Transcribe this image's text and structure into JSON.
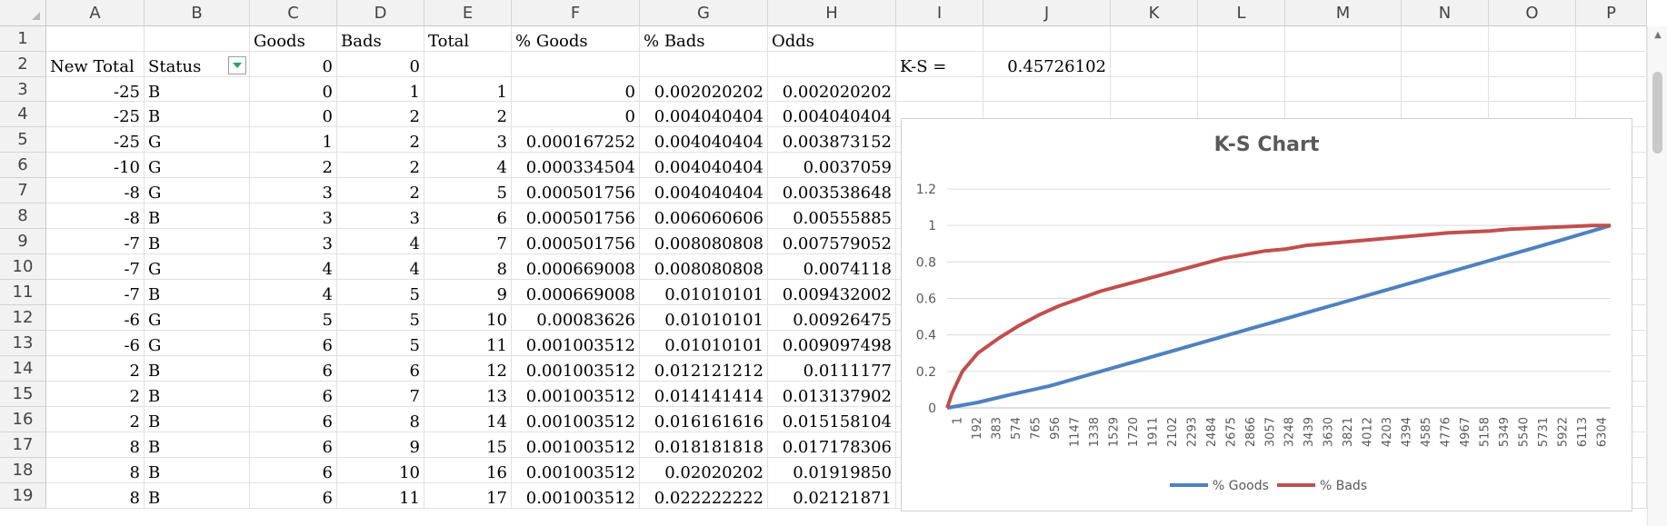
{
  "columns": [
    "A",
    "B",
    "C",
    "D",
    "E",
    "F",
    "G",
    "H",
    "I",
    "J",
    "K",
    "L",
    "M",
    "N",
    "O",
    "P"
  ],
  "row_numbers": [
    "1",
    "2",
    "3",
    "4",
    "5",
    "6",
    "7",
    "8",
    "9",
    "10",
    "11",
    "12",
    "13",
    "14",
    "15",
    "16",
    "17",
    "18",
    "19"
  ],
  "header_row": {
    "C": "Goods",
    "D": "Bads",
    "E": "Total",
    "F": "% Goods",
    "G": "% Bads",
    "H": "Odds"
  },
  "row2": {
    "A": "New Total",
    "B": "Status",
    "C": "0",
    "D": "0",
    "I": "K-S =",
    "J": "0.45726102"
  },
  "data_rows": [
    [
      "-25",
      "B",
      "0",
      "1",
      "1",
      "0",
      "0.002020202",
      "0.002020202"
    ],
    [
      "-25",
      "B",
      "0",
      "2",
      "2",
      "0",
      "0.004040404",
      "0.004040404"
    ],
    [
      "-25",
      "G",
      "1",
      "2",
      "3",
      "0.000167252",
      "0.004040404",
      "0.003873152"
    ],
    [
      "-10",
      "G",
      "2",
      "2",
      "4",
      "0.000334504",
      "0.004040404",
      "0.0037059"
    ],
    [
      "-8",
      "G",
      "3",
      "2",
      "5",
      "0.000501756",
      "0.004040404",
      "0.003538648"
    ],
    [
      "-8",
      "B",
      "3",
      "3",
      "6",
      "0.000501756",
      "0.006060606",
      "0.00555885"
    ],
    [
      "-7",
      "B",
      "3",
      "4",
      "7",
      "0.000501756",
      "0.008080808",
      "0.007579052"
    ],
    [
      "-7",
      "G",
      "4",
      "4",
      "8",
      "0.000669008",
      "0.008080808",
      "0.0074118"
    ],
    [
      "-7",
      "B",
      "4",
      "5",
      "9",
      "0.000669008",
      "0.01010101",
      "0.009432002"
    ],
    [
      "-6",
      "G",
      "5",
      "5",
      "10",
      "0.00083626",
      "0.01010101",
      "0.00926475"
    ],
    [
      "-6",
      "G",
      "6",
      "5",
      "11",
      "0.001003512",
      "0.01010101",
      "0.009097498"
    ],
    [
      "2",
      "B",
      "6",
      "6",
      "12",
      "0.001003512",
      "0.012121212",
      "0.0111177"
    ],
    [
      "2",
      "B",
      "6",
      "7",
      "13",
      "0.001003512",
      "0.014141414",
      "0.013137902"
    ],
    [
      "2",
      "B",
      "6",
      "8",
      "14",
      "0.001003512",
      "0.016161616",
      "0.015158104"
    ],
    [
      "8",
      "B",
      "6",
      "9",
      "15",
      "0.001003512",
      "0.018181818",
      "0.017178306"
    ],
    [
      "8",
      "B",
      "6",
      "10",
      "16",
      "0.001003512",
      "0.02020202",
      "0.01919850"
    ],
    [
      "8",
      "B",
      "6",
      "11",
      "17",
      "0.001003512",
      "0.022222222",
      "0.02121871"
    ]
  ],
  "chart_data": {
    "type": "line",
    "title": "K-S Chart",
    "x_tick_labels": [
      "1",
      "192",
      "383",
      "574",
      "765",
      "956",
      "1147",
      "1338",
      "1529",
      "1720",
      "1911",
      "2102",
      "2293",
      "2484",
      "2675",
      "2866",
      "3057",
      "3248",
      "3439",
      "3630",
      "3821",
      "4012",
      "4203",
      "4394",
      "4585",
      "4776",
      "4967",
      "5158",
      "5349",
      "5540",
      "5731",
      "5922",
      "6113",
      "6304"
    ],
    "x_range": [
      1,
      6480
    ],
    "ylim": [
      0,
      1.2
    ],
    "y_ticks": [
      "0",
      "0.2",
      "0.4",
      "0.6",
      "0.8",
      "1",
      "1.2"
    ],
    "grid": true,
    "legend_position": "bottom",
    "series": [
      {
        "name": "% Goods",
        "color": "#4f81bd",
        "x": [
          1,
          300,
          600,
          1000,
          1500,
          2000,
          2500,
          3000,
          3500,
          4000,
          4500,
          5000,
          5500,
          6000,
          6480
        ],
        "y": [
          0,
          0.03,
          0.07,
          0.12,
          0.2,
          0.28,
          0.36,
          0.44,
          0.52,
          0.6,
          0.68,
          0.76,
          0.84,
          0.92,
          1.0
        ]
      },
      {
        "name": "% Bads",
        "color": "#c0504d",
        "x": [
          1,
          50,
          150,
          300,
          500,
          700,
          900,
          1100,
          1300,
          1500,
          1700,
          1900,
          2100,
          2300,
          2500,
          2700,
          2900,
          3100,
          3300,
          3500,
          3700,
          3900,
          4100,
          4300,
          4500,
          4700,
          4900,
          5100,
          5300,
          5500,
          5700,
          5900,
          6100,
          6300,
          6480
        ],
        "y": [
          0,
          0.08,
          0.2,
          0.3,
          0.38,
          0.45,
          0.51,
          0.56,
          0.6,
          0.64,
          0.67,
          0.7,
          0.73,
          0.76,
          0.79,
          0.82,
          0.84,
          0.86,
          0.87,
          0.89,
          0.9,
          0.91,
          0.92,
          0.93,
          0.94,
          0.95,
          0.96,
          0.965,
          0.97,
          0.98,
          0.985,
          0.99,
          0.995,
          1.0,
          1.0
        ]
      }
    ]
  }
}
